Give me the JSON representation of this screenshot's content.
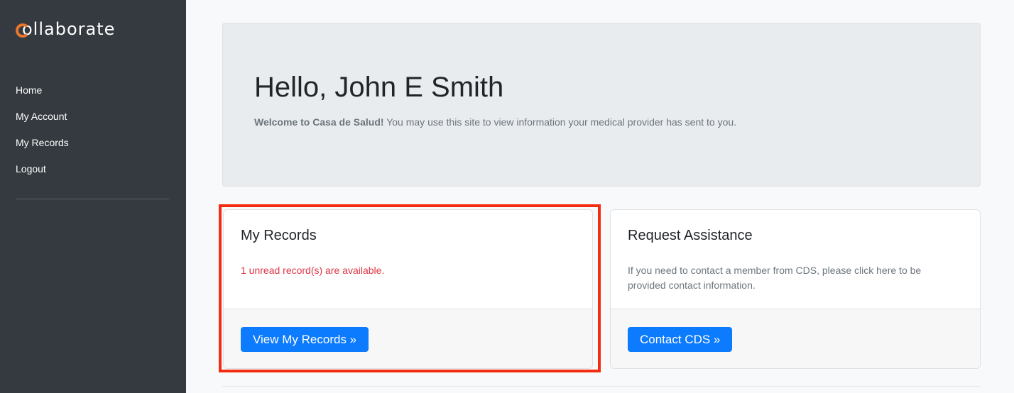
{
  "brand": {
    "logo_text": "ollaborate",
    "accent_color": "#e8772e"
  },
  "sidebar": {
    "items": [
      {
        "label": "Home"
      },
      {
        "label": "My Account"
      },
      {
        "label": "My Records"
      },
      {
        "label": "Logout"
      }
    ]
  },
  "jumbotron": {
    "greeting": "Hello, John E Smith",
    "welcome_bold": "Welcome to Casa de Salud!",
    "welcome_text": " You may use this site to view information your medical provider has sent to you."
  },
  "records_card": {
    "title": "My Records",
    "status_text": "1 unread record(s) are available.",
    "button_label": "View My Records »",
    "highlighted": true,
    "highlight_color": "#f42c10"
  },
  "assist_card": {
    "title": "Request Assistance",
    "text": "If you need to contact a member from CDS, please click here to be provided contact information.",
    "button_label": "Contact CDS »"
  },
  "colors": {
    "sidebar_bg": "#343a40",
    "primary_button": "#0d7bfd",
    "danger_text": "#dc3545"
  }
}
